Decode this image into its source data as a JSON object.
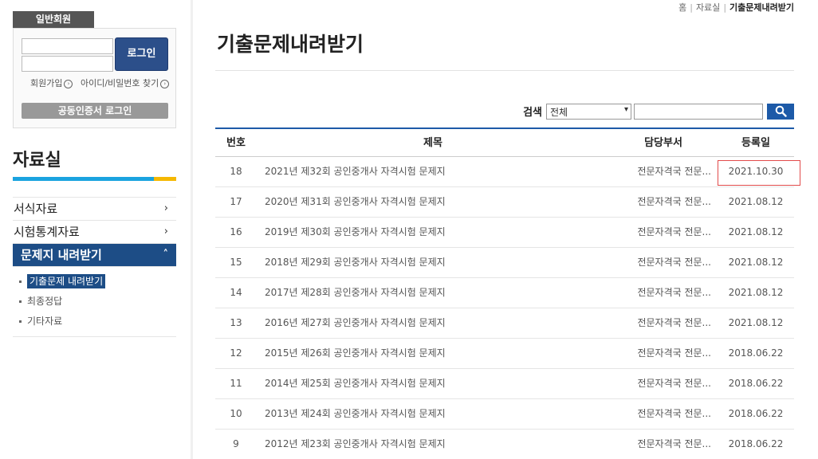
{
  "sidebar": {
    "login_tab": "일반회원",
    "login_button": "로그인",
    "join_link": "회원가입",
    "find_link": "아이디/비밀번호 찾기",
    "cert_button": "공동인증서 로그인",
    "title": "자료실",
    "menu": [
      {
        "label": "서식자료",
        "arrow": "›"
      },
      {
        "label": "시험통계자료",
        "arrow": "›"
      },
      {
        "label": "문제지 내려받기",
        "arrow": "˄"
      }
    ],
    "submenu": [
      {
        "label": "기출문제 내려받기"
      },
      {
        "label": "최종정답"
      },
      {
        "label": "기타자료"
      }
    ]
  },
  "breadcrumb": {
    "home": "홈",
    "section": "자료실",
    "current": "기출문제내려받기"
  },
  "page": {
    "title": "기출문제내려받기"
  },
  "search": {
    "label": "검색",
    "select_value": "전체"
  },
  "table": {
    "headers": {
      "no": "번호",
      "title": "제목",
      "dept": "담당부서",
      "date": "등록일"
    },
    "rows": [
      {
        "no": "18",
        "title": "2021년 제32회 공인중개사 자격시험 문제지",
        "dept": "전문자격국 전문...",
        "date": "2021.10.30"
      },
      {
        "no": "17",
        "title": "2020년 제31회 공인중개사 자격시험 문제지",
        "dept": "전문자격국 전문...",
        "date": "2021.08.12"
      },
      {
        "no": "16",
        "title": "2019년 제30회 공인중개사 자격시험 문제지",
        "dept": "전문자격국 전문...",
        "date": "2021.08.12"
      },
      {
        "no": "15",
        "title": "2018년 제29회 공인중개사 자격시험 문제지",
        "dept": "전문자격국 전문...",
        "date": "2021.08.12"
      },
      {
        "no": "14",
        "title": "2017년 제28회 공인중개사 자격시험 문제지",
        "dept": "전문자격국 전문...",
        "date": "2021.08.12"
      },
      {
        "no": "13",
        "title": "2016년 제27회 공인중개사 자격시험 문제지",
        "dept": "전문자격국 전문...",
        "date": "2021.08.12"
      },
      {
        "no": "12",
        "title": "2015년 제26회 공인중개사 자격시험 문제지",
        "dept": "전문자격국 전문...",
        "date": "2018.06.22"
      },
      {
        "no": "11",
        "title": "2014년 제25회 공인중개사 자격시험 문제지",
        "dept": "전문자격국 전문...",
        "date": "2018.06.22"
      },
      {
        "no": "10",
        "title": "2013년 제24회 공인중개사 자격시험 문제지",
        "dept": "전문자격국 전문...",
        "date": "2018.06.22"
      },
      {
        "no": "9",
        "title": "2012년 제23회 공인중개사 자격시험 문제지",
        "dept": "전문자격국 전문...",
        "date": "2018.06.22"
      }
    ]
  },
  "colors": {
    "primary": "#1d5aa8",
    "nav_active": "#1d4d86",
    "accent_blue": "#1aa3df",
    "accent_yellow": "#f5b800",
    "highlight": "#e24b4b"
  }
}
